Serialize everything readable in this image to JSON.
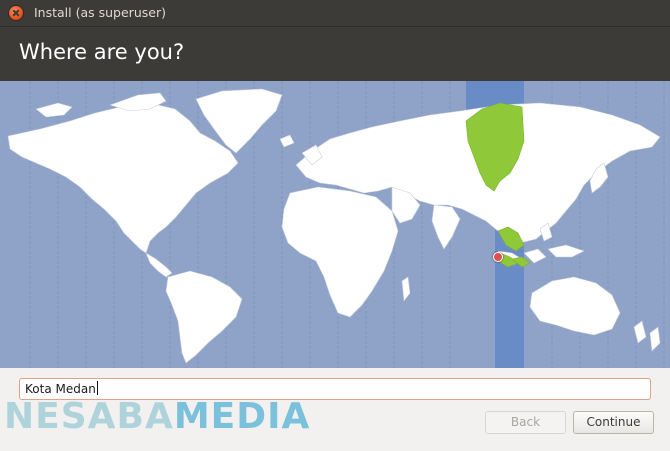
{
  "window": {
    "title": "Install (as superuser)",
    "close_icon": "close-icon"
  },
  "header": {
    "title": "Where are you?"
  },
  "map": {
    "selected_city": "Kota Medan",
    "highlight_color": "#6a8cc6",
    "land_color": "#ffffff",
    "selected_region_color": "#8fc93a",
    "ocean_color": "#8ea3c7"
  },
  "location": {
    "value": "Kota Medan"
  },
  "watermark": {
    "part1": "NESABA",
    "part2": "MEDIA"
  },
  "buttons": {
    "back_label": "Back",
    "continue_label": "Continue"
  }
}
